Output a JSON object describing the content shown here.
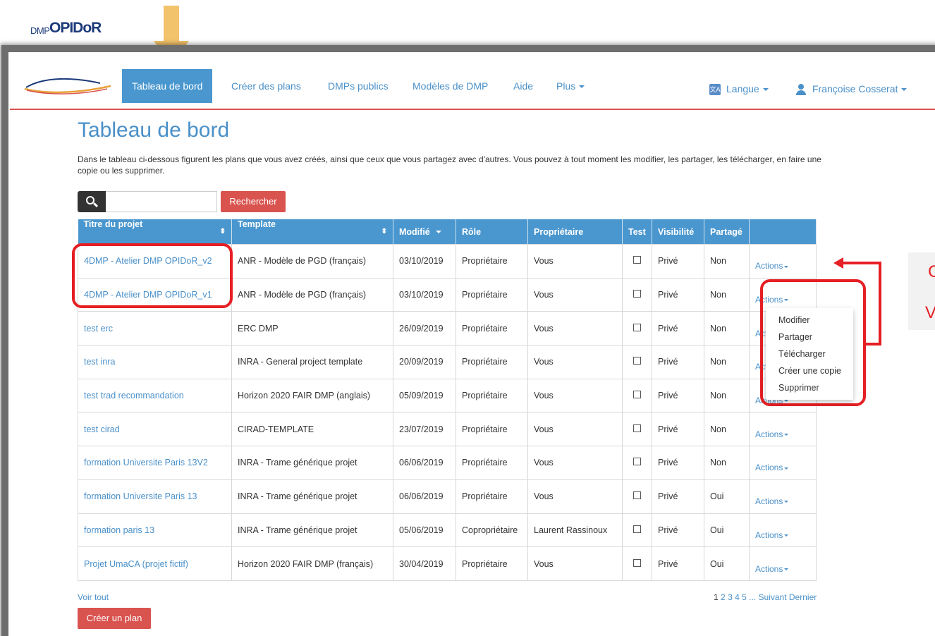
{
  "nav": {
    "logo_dmp": "DMP",
    "logo_opidor": "OPIDoR",
    "items": [
      "Tableau de bord",
      "Créer des plans",
      "DMPs publics",
      "Modèles de DMP",
      "Aide",
      "Plus"
    ],
    "language": "Langue",
    "user": "Françoise Cosserat"
  },
  "page": {
    "title": "Tableau de bord",
    "intro": "Dans le tableau ci-dessous figurent les plans que vous avez créés, ainsi que ceux que vous partagez avec d'autres. Vous pouvez à tout moment les modifier, les partager, les télécharger, en faire une copie ou les supprimer."
  },
  "search": {
    "placeholder": "",
    "button": "Rechercher"
  },
  "table": {
    "headers": [
      "Titre du projet",
      "Template",
      "Modifié",
      "Rôle",
      "Propriétaire",
      "Test",
      "Visibilité",
      "Partagé",
      ""
    ],
    "actions_label": "Actions",
    "rows": [
      {
        "title": "4DMP - Atelier DMP OPIDoR_v2",
        "template": "ANR - Modèle de PGD (français)",
        "modified": "03/10/2019",
        "role": "Propriétaire",
        "owner": "Vous",
        "visibility": "Privé",
        "shared": "Non"
      },
      {
        "title": "4DMP - Atelier DMP OPIDoR_v1",
        "template": "ANR - Modèle de PGD (français)",
        "modified": "03/10/2019",
        "role": "Propriétaire",
        "owner": "Vous",
        "visibility": "Privé",
        "shared": "Non"
      },
      {
        "title": "test erc",
        "template": "ERC DMP",
        "modified": "26/09/2019",
        "role": "Propriétaire",
        "owner": "Vous",
        "visibility": "Privé",
        "shared": "Non"
      },
      {
        "title": "test inra",
        "template": "INRA - General project template",
        "modified": "20/09/2019",
        "role": "Propriétaire",
        "owner": "Vous",
        "visibility": "Privé",
        "shared": "Non"
      },
      {
        "title": "test trad recommandation",
        "template": "Horizon 2020 FAIR DMP (anglais)",
        "modified": "05/09/2019",
        "role": "Propriétaire",
        "owner": "Vous",
        "visibility": "Privé",
        "shared": "Non"
      },
      {
        "title": "test cirad",
        "template": "CIRAD-TEMPLATE",
        "modified": "23/07/2019",
        "role": "Propriétaire",
        "owner": "Vous",
        "visibility": "Privé",
        "shared": "Non"
      },
      {
        "title": "formation Universite Paris 13V2",
        "template": "INRA - Trame générique projet",
        "modified": "06/06/2019",
        "role": "Propriétaire",
        "owner": "Vous",
        "visibility": "Privé",
        "shared": "Non"
      },
      {
        "title": "formation Universite Paris 13",
        "template": "INRA - Trame générique projet",
        "modified": "06/06/2019",
        "role": "Propriétaire",
        "owner": "Vous",
        "visibility": "Privé",
        "shared": "Oui"
      },
      {
        "title": "formation paris 13",
        "template": "INRA - Trame générique projet",
        "modified": "05/06/2019",
        "role": "Copropriétaire",
        "owner": "Laurent Rassinoux",
        "visibility": "Privé",
        "shared": "Oui"
      },
      {
        "title": "Projet UmaCA (projet fictif)",
        "template": "Horizon 2020 FAIR DMP (français)",
        "modified": "30/04/2019",
        "role": "Propriétaire",
        "owner": "Vous",
        "visibility": "Privé",
        "shared": "Oui"
      }
    ]
  },
  "dropdown": {
    "items": [
      "Modifier",
      "Partager",
      "Télécharger",
      "Créer une copie",
      "Supprimer"
    ]
  },
  "footer": {
    "voir_tout": "Voir tout",
    "pages": [
      "1",
      "2",
      "3",
      "4",
      "5"
    ],
    "ellipsis": "...",
    "next": "Suivant",
    "last": "Dernier",
    "create": "Créer un plan"
  },
  "callout": {
    "line1": "C",
    "line2": "V"
  },
  "colors": {
    "accent": "#4a97cf",
    "danger": "#d9534f",
    "annotation_red": "#e51f24",
    "annotation_arrow": "#f3c36b"
  }
}
